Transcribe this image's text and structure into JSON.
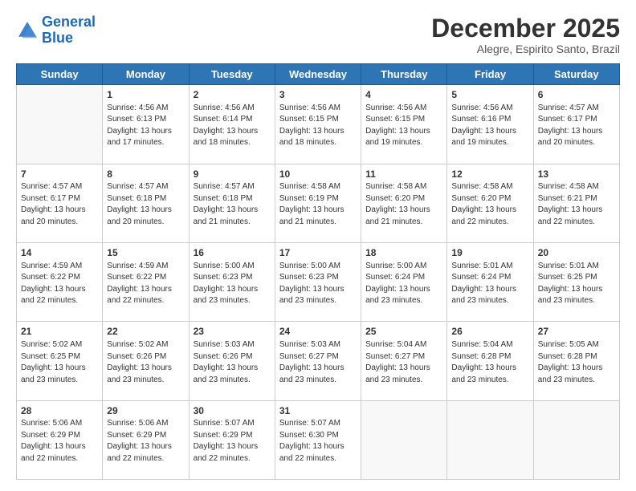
{
  "logo": {
    "line1": "General",
    "line2": "Blue"
  },
  "title": "December 2025",
  "location": "Alegre, Espirito Santo, Brazil",
  "weekdays": [
    "Sunday",
    "Monday",
    "Tuesday",
    "Wednesday",
    "Thursday",
    "Friday",
    "Saturday"
  ],
  "weeks": [
    [
      {
        "day": "",
        "sunrise": "",
        "sunset": "",
        "daylight": ""
      },
      {
        "day": "1",
        "sunrise": "4:56 AM",
        "sunset": "6:13 PM",
        "daylight": "13 hours and 17 minutes."
      },
      {
        "day": "2",
        "sunrise": "4:56 AM",
        "sunset": "6:14 PM",
        "daylight": "13 hours and 18 minutes."
      },
      {
        "day": "3",
        "sunrise": "4:56 AM",
        "sunset": "6:15 PM",
        "daylight": "13 hours and 18 minutes."
      },
      {
        "day": "4",
        "sunrise": "4:56 AM",
        "sunset": "6:15 PM",
        "daylight": "13 hours and 19 minutes."
      },
      {
        "day": "5",
        "sunrise": "4:56 AM",
        "sunset": "6:16 PM",
        "daylight": "13 hours and 19 minutes."
      },
      {
        "day": "6",
        "sunrise": "4:57 AM",
        "sunset": "6:17 PM",
        "daylight": "13 hours and 20 minutes."
      }
    ],
    [
      {
        "day": "7",
        "sunrise": "4:57 AM",
        "sunset": "6:17 PM",
        "daylight": "13 hours and 20 minutes."
      },
      {
        "day": "8",
        "sunrise": "4:57 AM",
        "sunset": "6:18 PM",
        "daylight": "13 hours and 20 minutes."
      },
      {
        "day": "9",
        "sunrise": "4:57 AM",
        "sunset": "6:18 PM",
        "daylight": "13 hours and 21 minutes."
      },
      {
        "day": "10",
        "sunrise": "4:58 AM",
        "sunset": "6:19 PM",
        "daylight": "13 hours and 21 minutes."
      },
      {
        "day": "11",
        "sunrise": "4:58 AM",
        "sunset": "6:20 PM",
        "daylight": "13 hours and 21 minutes."
      },
      {
        "day": "12",
        "sunrise": "4:58 AM",
        "sunset": "6:20 PM",
        "daylight": "13 hours and 22 minutes."
      },
      {
        "day": "13",
        "sunrise": "4:58 AM",
        "sunset": "6:21 PM",
        "daylight": "13 hours and 22 minutes."
      }
    ],
    [
      {
        "day": "14",
        "sunrise": "4:59 AM",
        "sunset": "6:22 PM",
        "daylight": "13 hours and 22 minutes."
      },
      {
        "day": "15",
        "sunrise": "4:59 AM",
        "sunset": "6:22 PM",
        "daylight": "13 hours and 22 minutes."
      },
      {
        "day": "16",
        "sunrise": "5:00 AM",
        "sunset": "6:23 PM",
        "daylight": "13 hours and 23 minutes."
      },
      {
        "day": "17",
        "sunrise": "5:00 AM",
        "sunset": "6:23 PM",
        "daylight": "13 hours and 23 minutes."
      },
      {
        "day": "18",
        "sunrise": "5:00 AM",
        "sunset": "6:24 PM",
        "daylight": "13 hours and 23 minutes."
      },
      {
        "day": "19",
        "sunrise": "5:01 AM",
        "sunset": "6:24 PM",
        "daylight": "13 hours and 23 minutes."
      },
      {
        "day": "20",
        "sunrise": "5:01 AM",
        "sunset": "6:25 PM",
        "daylight": "13 hours and 23 minutes."
      }
    ],
    [
      {
        "day": "21",
        "sunrise": "5:02 AM",
        "sunset": "6:25 PM",
        "daylight": "13 hours and 23 minutes."
      },
      {
        "day": "22",
        "sunrise": "5:02 AM",
        "sunset": "6:26 PM",
        "daylight": "13 hours and 23 minutes."
      },
      {
        "day": "23",
        "sunrise": "5:03 AM",
        "sunset": "6:26 PM",
        "daylight": "13 hours and 23 minutes."
      },
      {
        "day": "24",
        "sunrise": "5:03 AM",
        "sunset": "6:27 PM",
        "daylight": "13 hours and 23 minutes."
      },
      {
        "day": "25",
        "sunrise": "5:04 AM",
        "sunset": "6:27 PM",
        "daylight": "13 hours and 23 minutes."
      },
      {
        "day": "26",
        "sunrise": "5:04 AM",
        "sunset": "6:28 PM",
        "daylight": "13 hours and 23 minutes."
      },
      {
        "day": "27",
        "sunrise": "5:05 AM",
        "sunset": "6:28 PM",
        "daylight": "13 hours and 23 minutes."
      }
    ],
    [
      {
        "day": "28",
        "sunrise": "5:06 AM",
        "sunset": "6:29 PM",
        "daylight": "13 hours and 22 minutes."
      },
      {
        "day": "29",
        "sunrise": "5:06 AM",
        "sunset": "6:29 PM",
        "daylight": "13 hours and 22 minutes."
      },
      {
        "day": "30",
        "sunrise": "5:07 AM",
        "sunset": "6:29 PM",
        "daylight": "13 hours and 22 minutes."
      },
      {
        "day": "31",
        "sunrise": "5:07 AM",
        "sunset": "6:30 PM",
        "daylight": "13 hours and 22 minutes."
      },
      {
        "day": "",
        "sunrise": "",
        "sunset": "",
        "daylight": ""
      },
      {
        "day": "",
        "sunrise": "",
        "sunset": "",
        "daylight": ""
      },
      {
        "day": "",
        "sunrise": "",
        "sunset": "",
        "daylight": ""
      }
    ]
  ]
}
